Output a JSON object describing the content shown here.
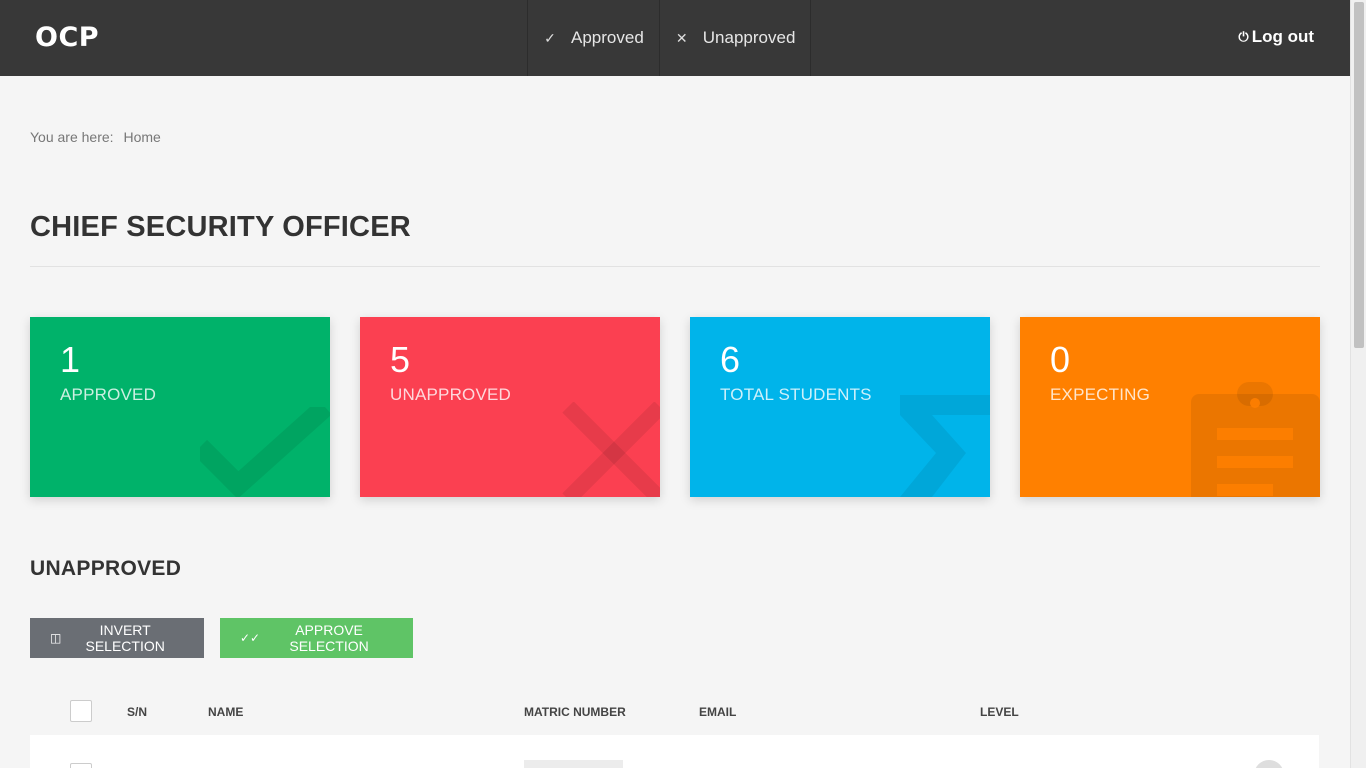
{
  "brand": "OCP",
  "nav": {
    "approved_label": "Approved",
    "unapproved_label": "Unapproved",
    "logout_label": "Log out"
  },
  "breadcrumb": {
    "prefix": "You are here:",
    "home": "Home"
  },
  "page_title": "CHIEF SECURITY OFFICER",
  "cards": [
    {
      "value": "1",
      "label": "APPROVED",
      "color": "#00b26a",
      "icon": "check-icon"
    },
    {
      "value": "5",
      "label": "UNAPPROVED",
      "color": "#fb4051",
      "icon": "close-icon"
    },
    {
      "value": "6",
      "label": "TOTAL STUDENTS",
      "color": "#00b4ea",
      "icon": "sigma-icon"
    },
    {
      "value": "0",
      "label": "EXPECTING",
      "color": "#ff8000",
      "icon": "clipboard-icon"
    }
  ],
  "section_title": "UNAPPROVED",
  "buttons": {
    "invert": "INVERT SELECTION",
    "approve": "APPROVE SELECTION"
  },
  "table": {
    "headers": {
      "sn": "S/N",
      "name": "NAME",
      "matric": "MATRIC NUMBER",
      "email": "EMAIL",
      "level": "LEVEL"
    }
  }
}
